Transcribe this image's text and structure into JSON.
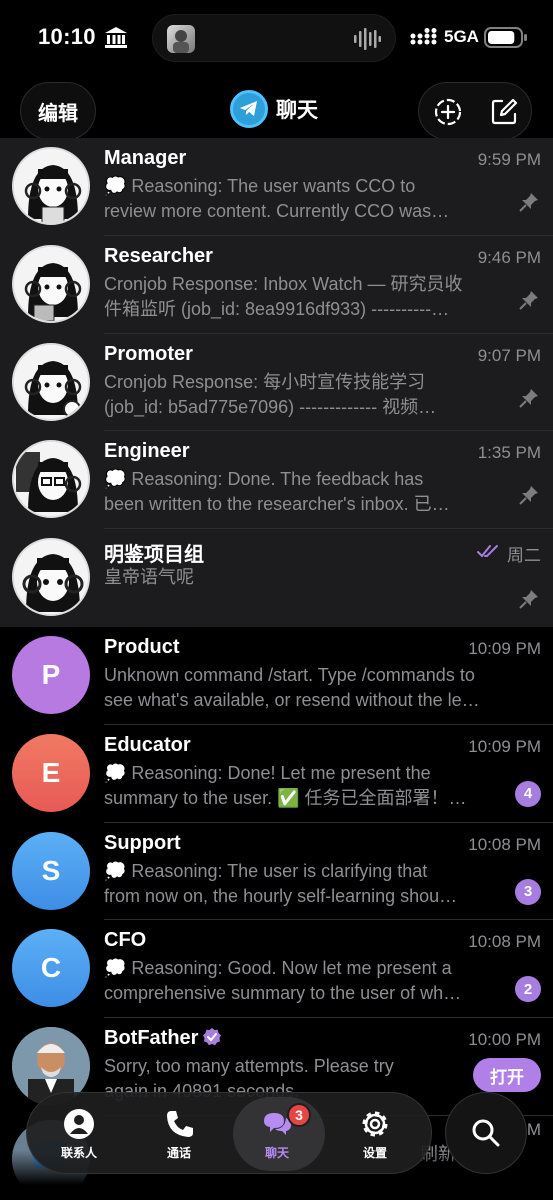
{
  "status": {
    "time": "10:10",
    "network": "5GA",
    "battery_level": 0.85
  },
  "header": {
    "edit_label": "编辑",
    "title": "聊天"
  },
  "chats": [
    {
      "name": "Manager",
      "time": "9:59 PM",
      "line1": "💭 Reasoning: The user wants CCO to",
      "line2": "review more content. Currently CCO was…",
      "pinned": true,
      "avatar": "manga"
    },
    {
      "name": "Researcher",
      "time": "9:46 PM",
      "line1": "Cronjob Response: Inbox Watch — 研究员收",
      "line2": "件箱监听 (job_id: 8ea9916df933) ----------…",
      "pinned": true,
      "avatar": "manga"
    },
    {
      "name": "Promoter",
      "time": "9:07 PM",
      "line1": "Cronjob Response: 每小时宣传技能学习",
      "line2": "(job_id: b5ad775e7096) ------------- 视频…",
      "pinned": true,
      "avatar": "manga"
    },
    {
      "name": "Engineer",
      "time": "1:35 PM",
      "line1": "💭 Reasoning: Done. The feedback has",
      "line2": "been written to the researcher's inbox. 已…",
      "pinned": true,
      "avatar": "manga"
    },
    {
      "name": "明鉴项目组",
      "time": "周二",
      "line1": "皇帝语气呢",
      "line2": "",
      "pinned": true,
      "avatar": "manga",
      "read": true
    },
    {
      "name": "Product",
      "time": "10:09 PM",
      "line1": "Unknown command /start. Type /commands to",
      "line2": "see what's available, or resend without the le…",
      "avatar_letter": "P",
      "avatar_color": "#b77ae0"
    },
    {
      "name": "Educator",
      "time": "10:09 PM",
      "line1": "💭 Reasoning: Done! Let me present the",
      "line2": "summary to the user. ✅ 任务已全面部署！…",
      "avatar_letter": "E",
      "avatar_color": "#ef6a5a",
      "badge": "4"
    },
    {
      "name": "Support",
      "time": "10:08 PM",
      "line1": "💭 Reasoning: The user is clarifying that",
      "line2": "from now on, the hourly self-learning shou…",
      "avatar_letter": "S",
      "avatar_color": "#4fa3ef",
      "badge": "3"
    },
    {
      "name": "CFO",
      "time": "10:08 PM",
      "line1": "💭 Reasoning: Good. Now let me present a",
      "line2": "comprehensive summary to the user of wh…",
      "avatar_letter": "C",
      "avatar_color": "#4fa3ef",
      "badge": "2"
    },
    {
      "name": "BotFather",
      "time": "10:00 PM",
      "line1": "Sorry, too many attempts. Please try",
      "line2": "again in 40891 seconds.",
      "verified": true,
      "open_label": "打开"
    }
  ],
  "partial_row": {
    "time": "PM",
    "snippet": "刷新"
  },
  "tabs": [
    {
      "label": "联系人",
      "icon": "person-icon"
    },
    {
      "label": "通话",
      "icon": "phone-icon"
    },
    {
      "label": "聊天",
      "icon": "chat-bubbles-icon",
      "badge": "3",
      "active": true
    },
    {
      "label": "设置",
      "icon": "gear-icon"
    }
  ],
  "colors": {
    "accent": "#a77ee0",
    "pinned_bg": "#1c1c1e",
    "secondary_text": "#8e8e93"
  }
}
